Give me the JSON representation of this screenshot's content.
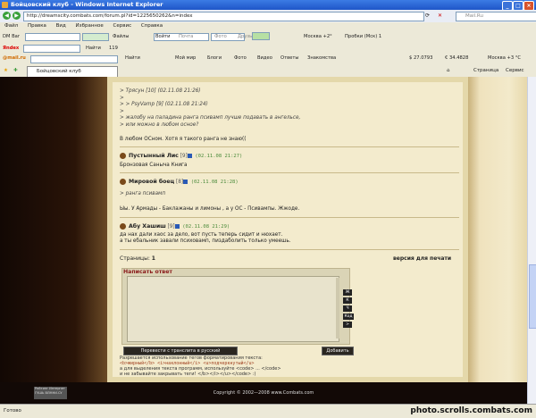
{
  "window": {
    "title": "Бойцовский клуб - Windows Internet Explorer"
  },
  "address": {
    "url": "http://dreamscity.combats.com/forum.pl?id=1225650262&n=index",
    "search_placeholder": "Mail.Ru"
  },
  "menu": [
    "Файл",
    "Правка",
    "Вид",
    "Избранное",
    "Сервис",
    "Справка"
  ],
  "toolbar1": {
    "label": "DM Bar",
    "files": "Файлы",
    "enter": "Войти",
    "mail": "Почта",
    "photo": "Фото",
    "friends": "Друзья",
    "weather": "Москва +2°",
    "traffic": "Пробки (Мск) 1"
  },
  "toolbar2": {
    "yandex": "Яndex",
    "find": "Найти",
    "count": "119"
  },
  "toolbar3": {
    "mailru": "@mail.ru",
    "find": "Найти",
    "items": [
      "Мой мир",
      "Блоги",
      "Фото",
      "Видео",
      "Ответы",
      "Знакомства"
    ],
    "usd": "$ 27.0793",
    "eur": "€ 34.4828",
    "weather": "Москва +3 °С"
  },
  "tabs": {
    "tab1": "Бойцовский клуб",
    "page": "Страница",
    "service": "Сервис"
  },
  "posts": [
    {
      "quotes": [
        "> Трясун [10]  (02.11.08 21:26)",
        ">",
        "> >  PsyVamp [9]  (02.11.08 21:24)",
        ">",
        "> жалобу на паладина ранга псивамп лучше подавать в ангельсе,",
        "> или можно в любом осное?"
      ],
      "body": "В любом ОСном. Хотя я такого ранга не знаю(("
    },
    {
      "author": "Пустынный Лис",
      "level": "[9]",
      "date": "(02.11.08 21:27)",
      "body": "Бронзовая Саныча Книга"
    },
    {
      "author": "Мировой боец",
      "level": "[8]",
      "date": "(02.11.08 21:28)",
      "quote": "> ранга псивамп",
      "body": "Ыы. У Армады - Баклажаны и лимоны , а у ОС - Псивампы. Жжоде."
    },
    {
      "author": "Абу Хашиш",
      "level": "[9]",
      "date": "(02.11.08 21:29)",
      "body": "да нах дали хаос за дело, вот пусть теперь сидит и нюхает.",
      "body2": "а ты ебальник завали психовамп, пиздаболить только умеешь."
    }
  ],
  "pages": {
    "label": "Страницы:",
    "current": "1",
    "print": "версия для печати"
  },
  "reply": {
    "title": "Написать ответ",
    "translit_btn": "Перевести с транслита в русский",
    "add_btn": "Добавить",
    "side_btns": [
      "Ж",
      "К",
      "Ч",
      "Код",
      ">"
    ]
  },
  "help": {
    "line1": "Разрешается использование тегов форматирования текста:",
    "line2": "<b>жирный</b> <i>наклонный</i> <u>подчеркнутый</u>",
    "line3": "а для выделения текста программ, используйте <code> ... </code>",
    "line4": "и не забывайте закрывать теги! </b></i></u></code> :)"
  },
  "footer": {
    "copyright": "Copyright © 2002—2008 www.Combats.com",
    "counter": "Рейтинг Интернет ГУШЬ ВЛМНИ.СУ"
  },
  "status": {
    "left": "Готово",
    "watermark": "photo.scrolls.combats.com"
  }
}
